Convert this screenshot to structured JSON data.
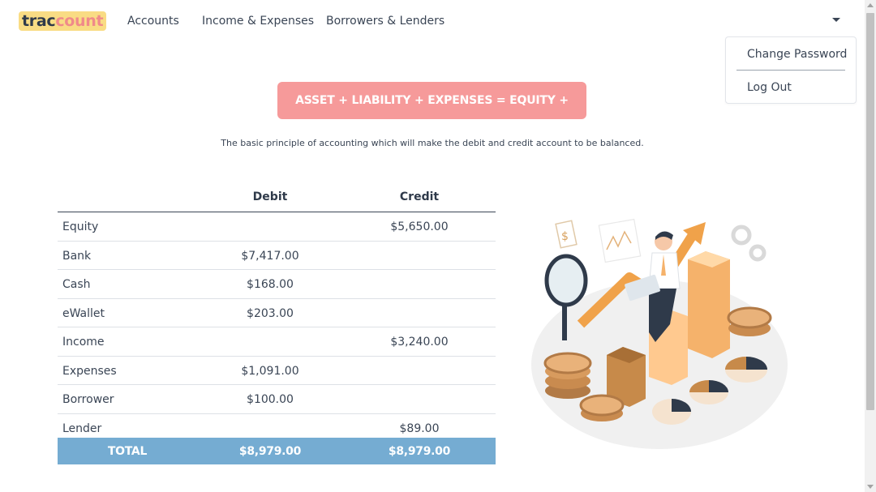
{
  "nav": {
    "logo_part1": "trac",
    "logo_part2": "count",
    "links": [
      "Accounts",
      "Income & Expenses",
      "Borrowers & Lenders"
    ]
  },
  "dropdown": {
    "items": [
      "Change Password",
      "Log Out"
    ]
  },
  "banner": {
    "formula": "ASSET + LIABILITY + EXPENSES = EQUITY + INCOME",
    "subtitle": "The basic principle of accounting which will make the debit and credit account to be balanced."
  },
  "table": {
    "headers": [
      "",
      "Debit",
      "Credit"
    ],
    "rows": [
      {
        "name": "Equity",
        "debit": "",
        "credit": "$5,650.00"
      },
      {
        "name": "Bank",
        "debit": "$7,417.00",
        "credit": ""
      },
      {
        "name": "Cash",
        "debit": "$168.00",
        "credit": ""
      },
      {
        "name": "eWallet",
        "debit": "$203.00",
        "credit": ""
      },
      {
        "name": "Income",
        "debit": "",
        "credit": "$3,240.00"
      },
      {
        "name": "Expenses",
        "debit": "$1,091.00",
        "credit": ""
      },
      {
        "name": "Borrower",
        "debit": "$100.00",
        "credit": ""
      },
      {
        "name": "Lender",
        "debit": "",
        "credit": "$89.00"
      }
    ],
    "total": {
      "name": "TOTAL",
      "debit": "$8,979.00",
      "credit": "$8,979.00"
    }
  },
  "colors": {
    "accent_pink": "#f69a9a",
    "logo_yellow": "#f9dc84",
    "total_blue": "#75acd2",
    "text_dark": "#2f3a4a"
  }
}
